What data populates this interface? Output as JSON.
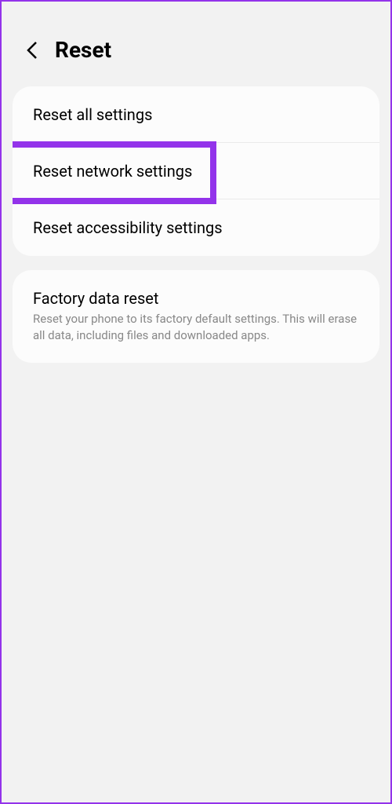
{
  "header": {
    "title": "Reset"
  },
  "section1": {
    "items": [
      {
        "title": "Reset all settings"
      },
      {
        "title": "Reset network settings"
      },
      {
        "title": "Reset accessibility settings"
      }
    ]
  },
  "section2": {
    "items": [
      {
        "title": "Factory data reset",
        "subtitle": "Reset your phone to its factory default settings. This will erase all data, including files and downloaded apps."
      }
    ]
  },
  "colors": {
    "highlight": "#9333ea"
  }
}
